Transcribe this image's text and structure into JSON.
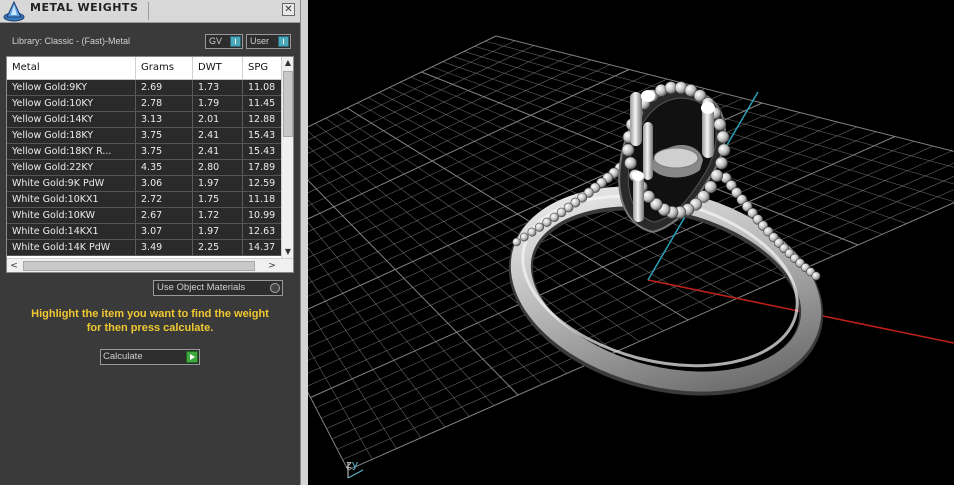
{
  "window": {
    "title": "METAL WEIGHTS",
    "close_glyph": "✕",
    "logo_icon": "app-logo-icon"
  },
  "library": {
    "label": "Library: Classic - (Fast)-Metal"
  },
  "toggles": {
    "gv_label": "GV",
    "user_label": "User",
    "accent": "#4aa9bd"
  },
  "table": {
    "columns": [
      "Metal",
      "Grams",
      "DWT",
      "SPG"
    ],
    "rows": [
      [
        "Yellow Gold:9KY",
        "2.69",
        "1.73",
        "11.08"
      ],
      [
        "Yellow Gold:10KY",
        "2.78",
        "1.79",
        "11.45"
      ],
      [
        "Yellow Gold:14KY",
        "3.13",
        "2.01",
        "12.88"
      ],
      [
        "Yellow Gold:18KY",
        "3.75",
        "2.41",
        "15.43"
      ],
      [
        "Yellow Gold:18KY R...",
        "3.75",
        "2.41",
        "15.43"
      ],
      [
        "Yellow Gold:22KY",
        "4.35",
        "2.80",
        "17.89"
      ],
      [
        "White Gold:9K PdW",
        "3.06",
        "1.97",
        "12.59"
      ],
      [
        "White Gold:10KX1",
        "2.72",
        "1.75",
        "11.18"
      ],
      [
        "White Gold:10KW",
        "2.67",
        "1.72",
        "10.99"
      ],
      [
        "White Gold:14KX1",
        "3.07",
        "1.97",
        "12.63"
      ],
      [
        "White Gold:14K PdW",
        "3.49",
        "2.25",
        "14.37"
      ]
    ]
  },
  "options": {
    "use_object_materials": "Use Object Materials"
  },
  "hint": {
    "line1": "Highlight the item you want to find the weight",
    "line2": "for then press calculate.",
    "color": "#f0c830"
  },
  "calculate": {
    "label": "Calculate",
    "go_color": "#3fa83f"
  },
  "viewport": {
    "axis_z": "z",
    "axis_y": "y",
    "grid_color": "#8a8a8a",
    "x_axis_color": "#c0201a",
    "y_axis_color": "#2aa0b8"
  }
}
